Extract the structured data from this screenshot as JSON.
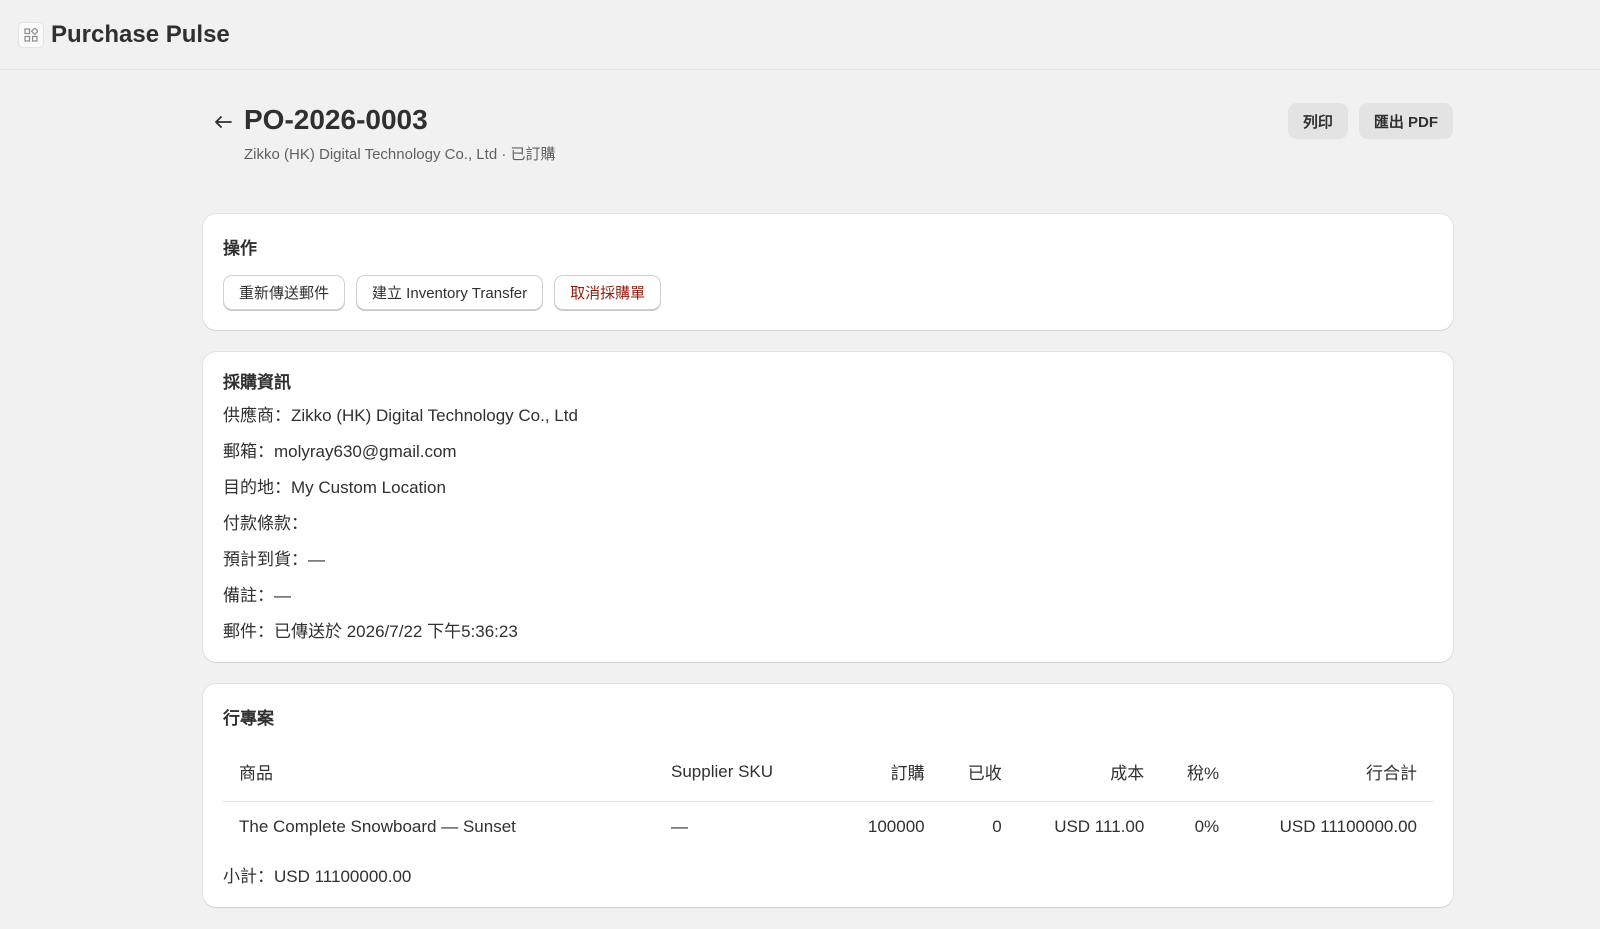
{
  "app": {
    "title": "Purchase Pulse",
    "icon": "apps-grid-icon"
  },
  "header": {
    "po_number": "PO-2026-0003",
    "subtitle": "Zikko (HK) Digital Technology Co., Ltd · 已訂購",
    "print_label": "列印",
    "export_label": "匯出 PDF"
  },
  "actions_card": {
    "title": "操作",
    "resend_label": "重新傳送郵件",
    "transfer_label": "建立 Inventory Transfer",
    "cancel_label": "取消採購單",
    "cancel_color": "#8e1f0b"
  },
  "info_card": {
    "title": "採購資訊",
    "supplier": "供應商：Zikko (HK) Digital Technology Co., Ltd",
    "email": "郵箱：molyray630@gmail.com",
    "destination": "目的地：My Custom Location",
    "payment_terms": "付款條款：",
    "expected_arrival": "預計到貨：—",
    "notes": "備註：—",
    "mail_status": "郵件：已傳送於 2026/7/22 下午5:36:23"
  },
  "lines_card": {
    "title": "行專案",
    "columns": {
      "product": "商品",
      "sku": "Supplier SKU",
      "ordered": "訂購",
      "received": "已收",
      "cost": "成本",
      "tax": "稅%",
      "total": "行合計"
    },
    "rows": [
      {
        "product": "The Complete Snowboard — Sunset",
        "sku": "—",
        "ordered": "100000",
        "received": "0",
        "cost": "USD 111.00",
        "tax": "0%",
        "total": "USD 11100000.00"
      }
    ],
    "subtotal": "小計：USD 11100000.00"
  }
}
